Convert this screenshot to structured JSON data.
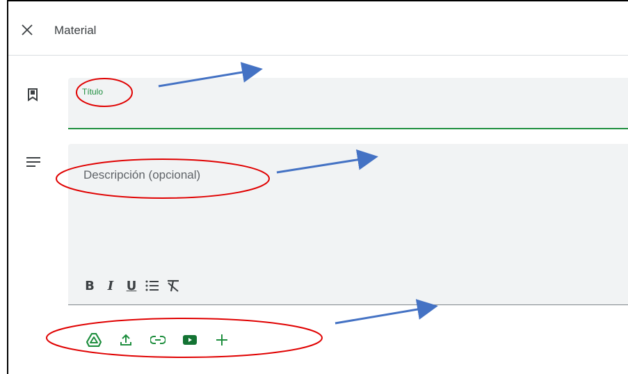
{
  "header": {
    "title": "Material",
    "close_icon": "close-icon"
  },
  "form": {
    "title_field": {
      "label": "Título",
      "icon": "bookmark-icon"
    },
    "description_field": {
      "placeholder": "Descripción (opcional)",
      "icon": "subject-icon"
    },
    "format_toolbar": [
      {
        "name": "bold",
        "label": "B"
      },
      {
        "name": "italic",
        "label": "I"
      },
      {
        "name": "underline",
        "label": "U"
      },
      {
        "name": "bulleted-list",
        "icon": "list-icon"
      },
      {
        "name": "clear-formatting",
        "icon": "clear-format-icon"
      }
    ],
    "attachments": [
      {
        "name": "google-drive",
        "icon": "drive-icon"
      },
      {
        "name": "upload",
        "icon": "upload-icon"
      },
      {
        "name": "link",
        "icon": "link-icon"
      },
      {
        "name": "youtube",
        "icon": "youtube-icon"
      },
      {
        "name": "create",
        "icon": "plus-icon"
      }
    ]
  },
  "colors": {
    "accent_green": "#1e8e3e",
    "field_bg": "#f1f3f4",
    "annotation_red": "#e00000",
    "annotation_arrow": "#4472c4"
  }
}
